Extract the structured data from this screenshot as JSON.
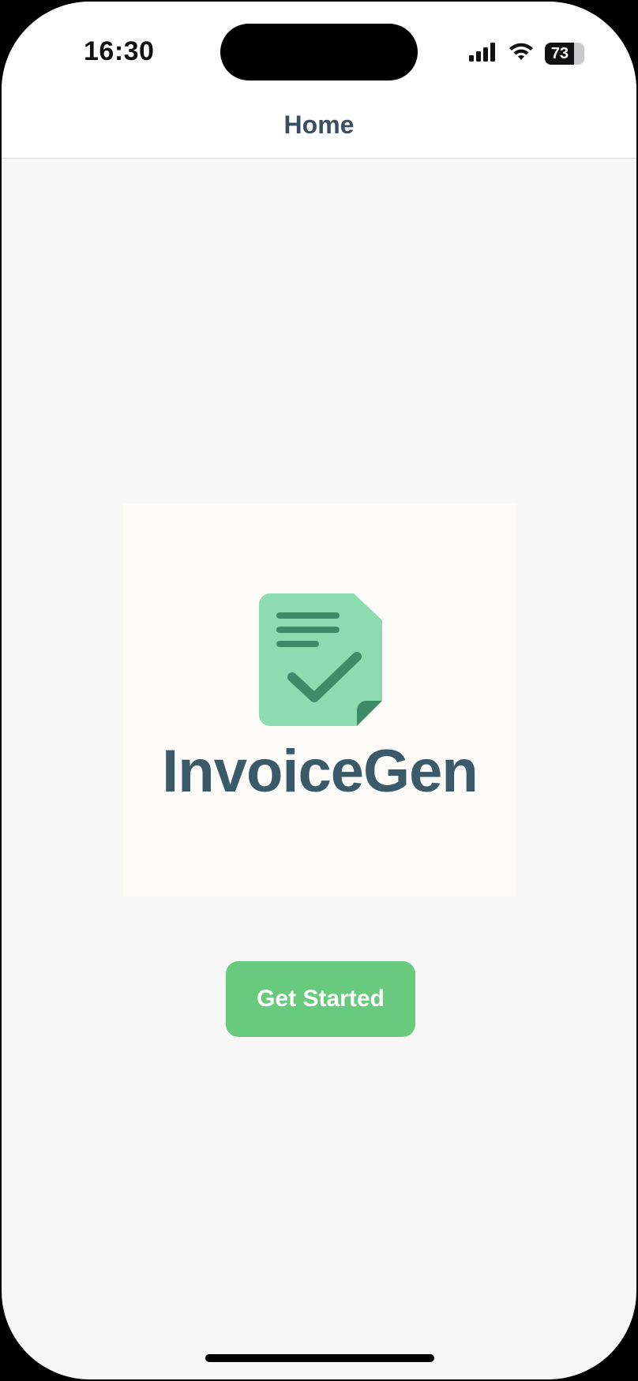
{
  "status_bar": {
    "time": "16:30",
    "battery_level": "73",
    "battery_fraction": 0.73,
    "icons": [
      "cellular-signal-icon",
      "wifi-icon",
      "battery-icon"
    ]
  },
  "nav": {
    "title": "Home"
  },
  "logo": {
    "icon": "invoice-document-check-icon",
    "text": "InvoiceGen",
    "colors": {
      "document": "#8ddcb1",
      "ink": "#3f8a68",
      "wordmark": "#3a5a6a"
    }
  },
  "actions": {
    "get_started_label": "Get Started",
    "button_color": "#67ca7d"
  }
}
